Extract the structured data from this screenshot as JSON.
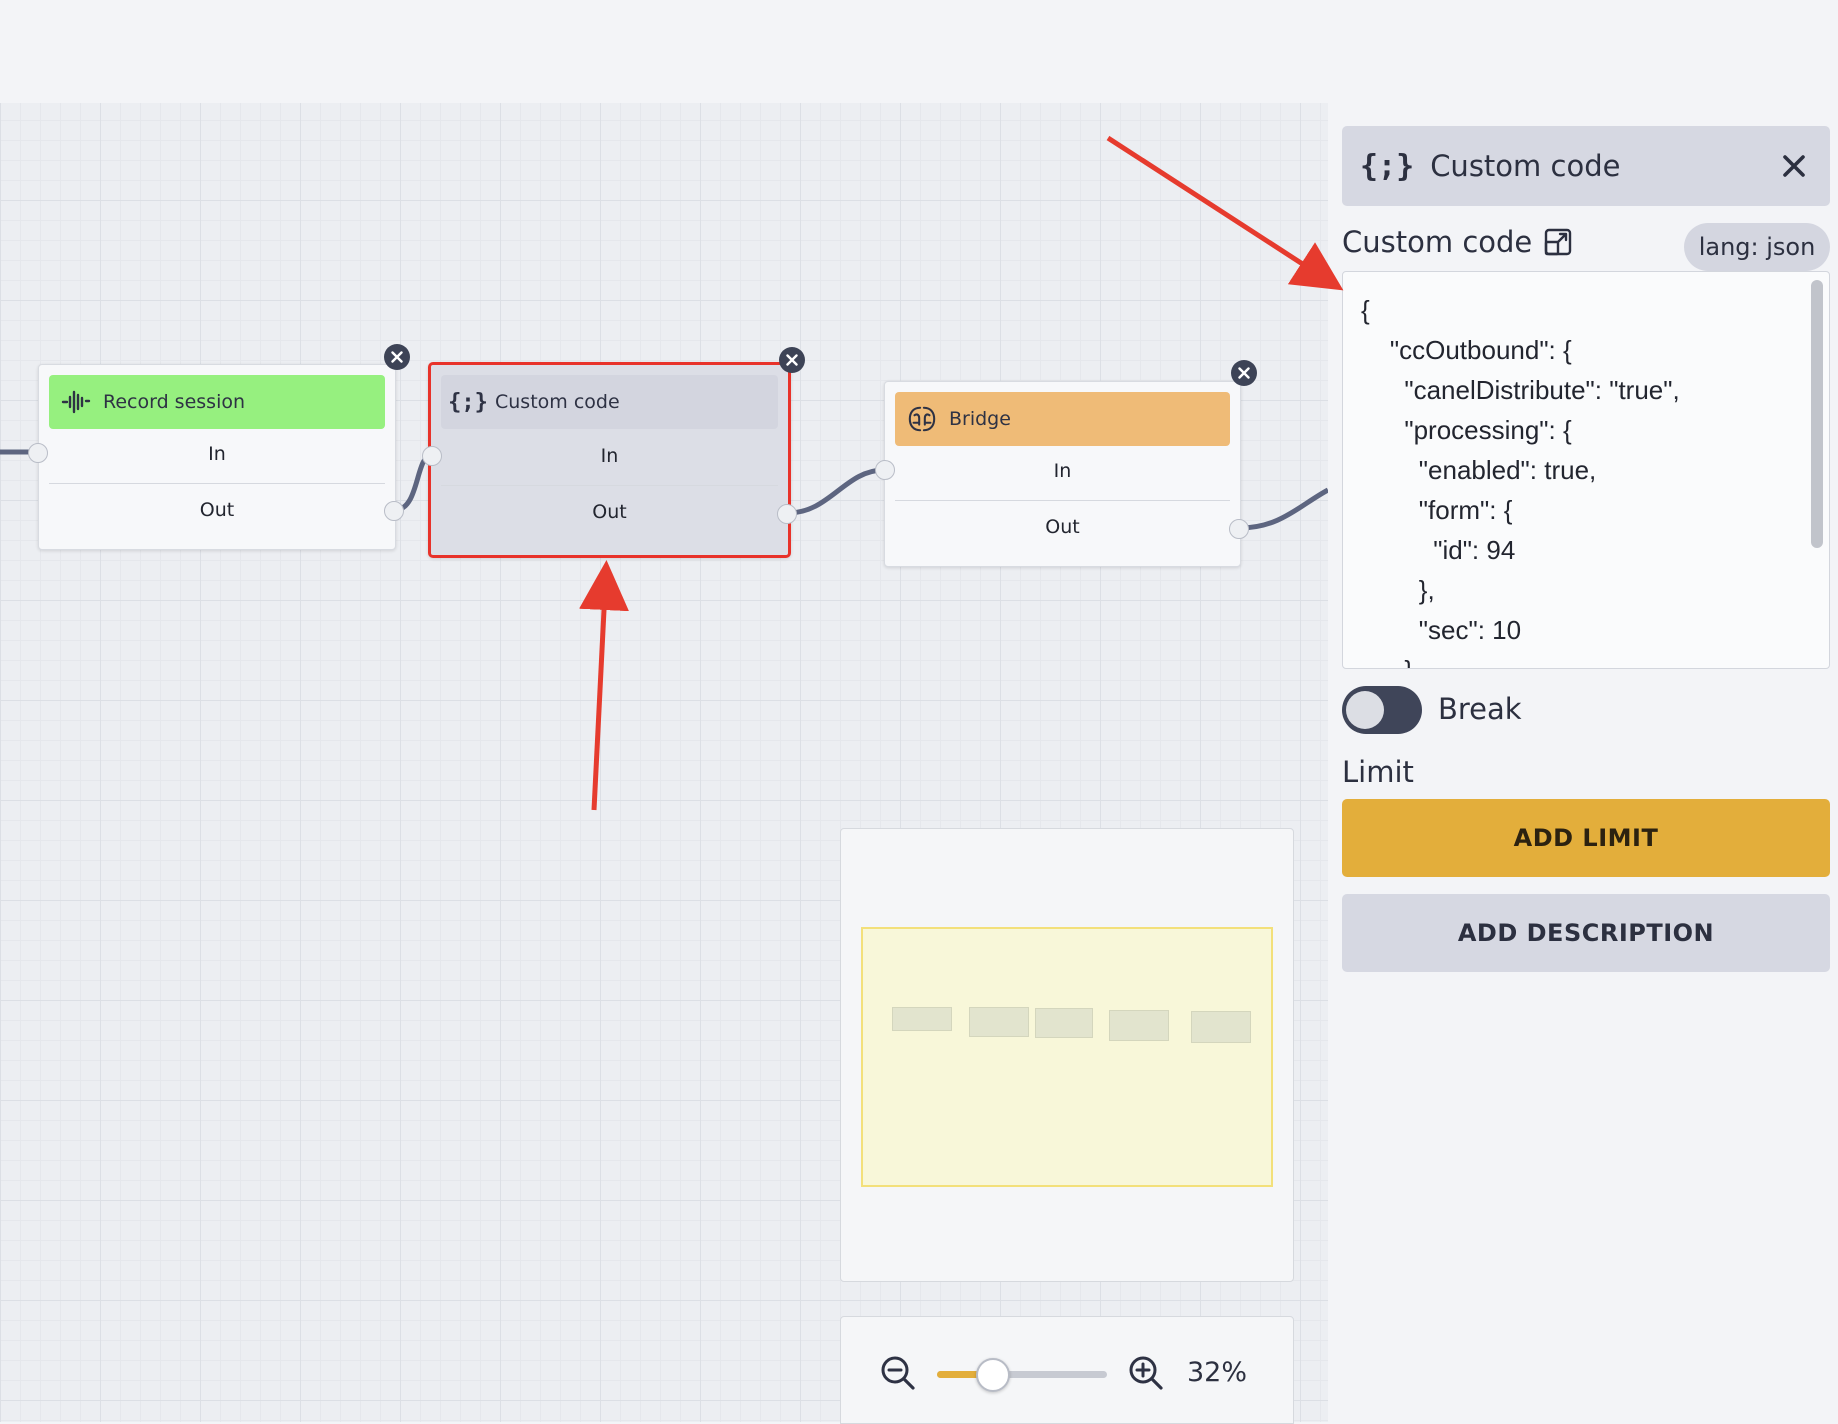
{
  "colors": {
    "record_session_header": "#96f07f",
    "custom_code_header": "#d3d5df",
    "bridge_header": "#efbb77",
    "selected_border": "#e8322a",
    "annotation_arrow": "#e63b2e",
    "wire": "#5d6580",
    "accent_yellow": "#e3ae3b"
  },
  "nodes": [
    {
      "title": "Record session",
      "icon": "waveform-icon",
      "in": "In",
      "out": "Out"
    },
    {
      "title": "Custom code",
      "icon": "curly-braces-icon",
      "in": "In",
      "out": "Out",
      "selected": true
    },
    {
      "title": "Bridge",
      "icon": "bridge-icon",
      "in": "In",
      "out": "Out"
    }
  ],
  "panel": {
    "title": "Custom code",
    "title_icon": "curly-braces-icon",
    "code_label": "Custom code",
    "code_label_icon": "expand-icon",
    "lang_badge": "lang: json",
    "code": "{\n    \"ccOutbound\": {\n      \"canelDistribute\": \"true\",\n      \"processing\": {\n        \"enabled\": true,\n        \"form\": {\n          \"id\": 94\n        },\n        \"sec\": 10\n      }",
    "break_label": "Break",
    "break_enabled": false,
    "limit_label": "Limit",
    "add_limit_button": "ADD LIMIT",
    "add_description_button": "ADD DESCRIPTION"
  },
  "zoom": {
    "percent_label": "32%",
    "slider_fraction": 0.32,
    "zoom_out_icon": "zoom-out-icon",
    "zoom_in_icon": "zoom-in-icon"
  }
}
